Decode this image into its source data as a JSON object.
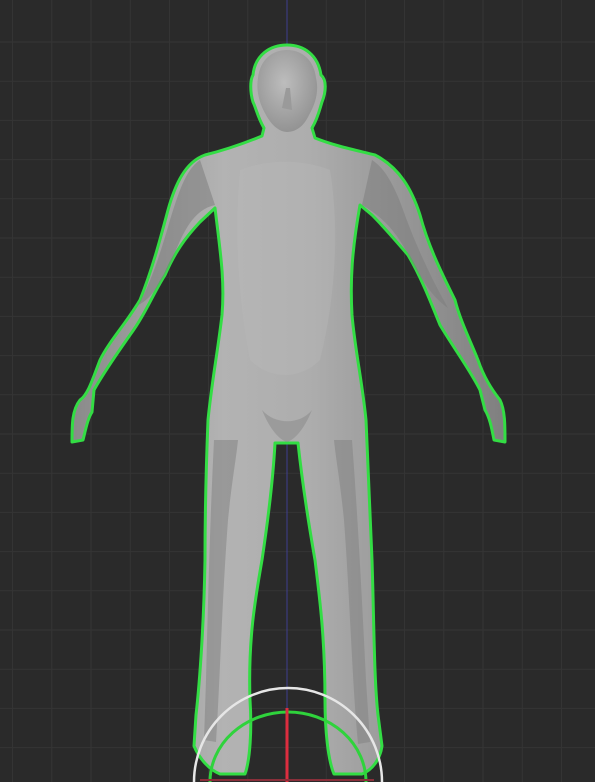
{
  "viewport": {
    "background": "#2a2a2a",
    "grid_minor_color": "#353535",
    "grid_major_color": "#474747",
    "axis_vertical_color": "#3f3f8f",
    "axis_horizontal_color": "#8a2f3a"
  },
  "model": {
    "body_color": "#a9a9a9",
    "selection_outline_color": "#33dd44",
    "selected": true,
    "object_type": "humanoid mesh"
  },
  "gizmo": {
    "type": "rotate-gizmo",
    "outer_ring_color": "#e6e6e6",
    "inner_ring_color": "#2fd33c",
    "axis_line_color": "#dd2d3f"
  }
}
